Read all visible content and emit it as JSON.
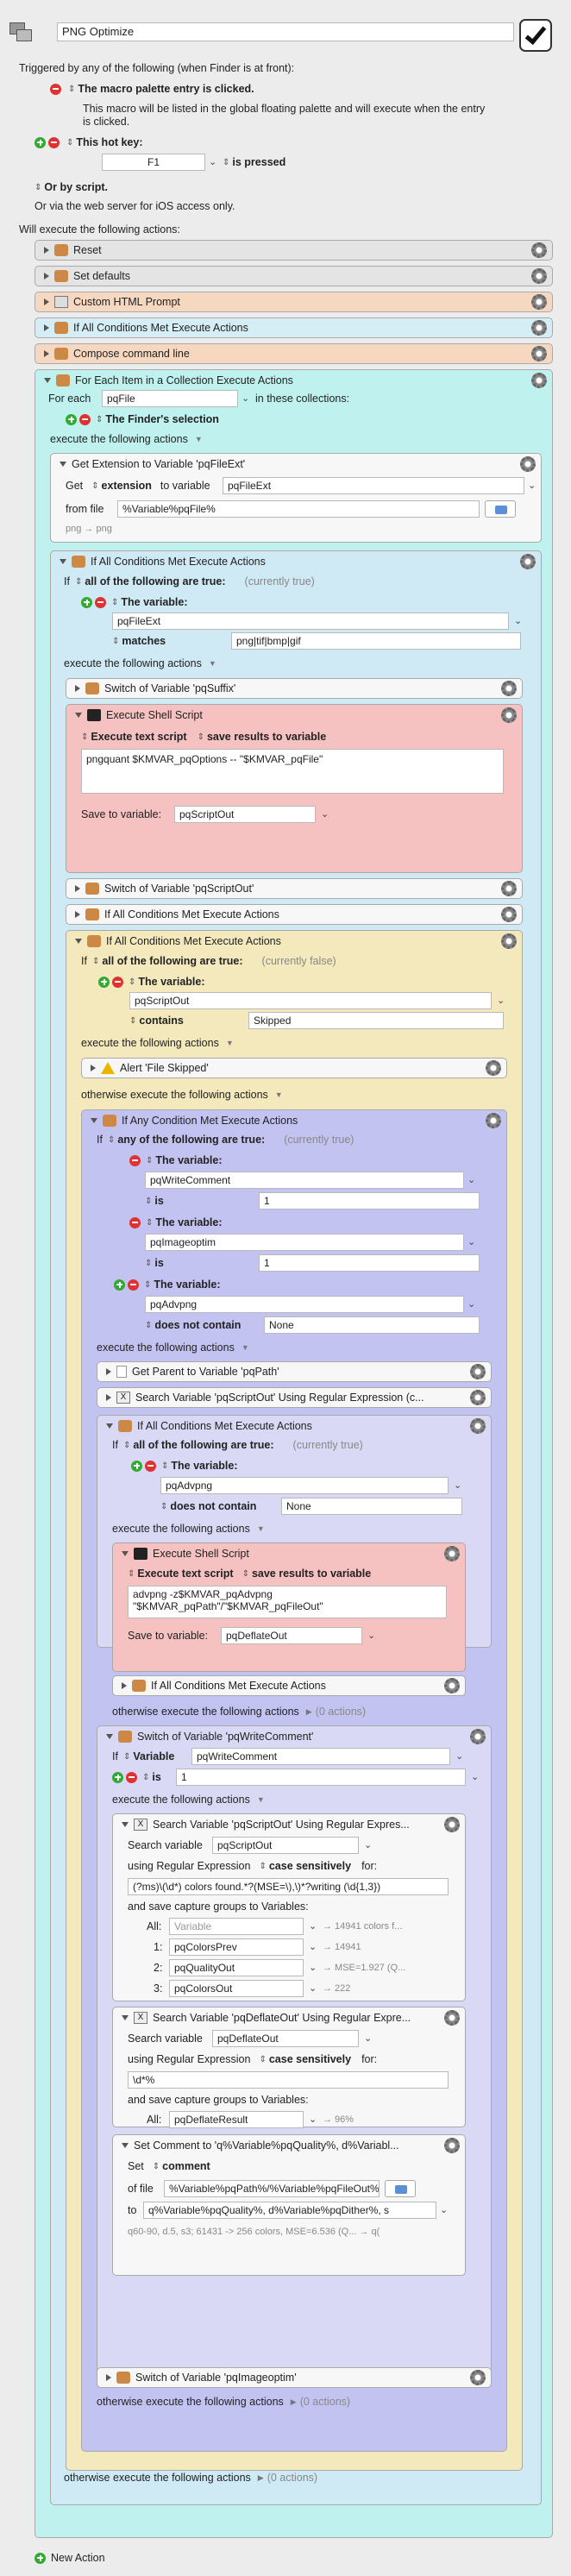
{
  "macro": {
    "name": "PNG Optimize"
  },
  "triggers": {
    "heading": "Triggered by any of the following (when Finder is at front):",
    "palette": "The macro palette entry is clicked.",
    "palette_desc1": "This macro will be listed in the global floating palette and will execute when the entry",
    "palette_desc2": "is clicked.",
    "hotkey": "This hot key:",
    "hotkey_value": "F1",
    "hotkey_mode": "is pressed",
    "script": "Or by script.",
    "web": "Or via the web server for iOS access only."
  },
  "will_execute": "Will execute the following actions:",
  "actions": {
    "reset": "Reset",
    "set_defaults": "Set defaults",
    "custom_html": "Custom HTML Prompt",
    "if_all": "If All Conditions Met Execute Actions",
    "compose": "Compose command line",
    "for_each": "For Each Item in a Collection Execute Actions"
  },
  "foreach": {
    "for_each": "For each",
    "var": "pqFile",
    "in_collections": "in these collections:",
    "selection": "The Finder's selection",
    "execute": "execute the following actions"
  },
  "getext": {
    "title": "Get Extension to Variable 'pqFileExt'",
    "get": "Get",
    "extension": "extension",
    "to_variable": "to variable",
    "var": "pqFileExt",
    "from_file": "from file",
    "file": "%Variable%pqFile%",
    "preview": "png → png"
  },
  "if1": {
    "title": "If All Conditions Met Execute Actions",
    "if": "If",
    "all": "all of the following are true:",
    "status": "(currently true)",
    "the_variable": "The variable:",
    "var": "pqFileExt",
    "matches": "matches",
    "pattern": "png|tif|bmp|gif",
    "execute": "execute the following actions"
  },
  "switch1": "Switch of Variable 'pqSuffix'",
  "shell1": {
    "title": "Execute Shell Script",
    "mode": "Execute text script",
    "save": "save results to variable",
    "script": "pngquant $KMVAR_pqOptions -- \"$KMVAR_pqFile\"",
    "save_to": "Save to variable:",
    "var": "pqScriptOut"
  },
  "switch2": "Switch of Variable 'pqScriptOut'",
  "if2": "If All Conditions Met Execute Actions",
  "if3": {
    "title": "If All Conditions Met Execute Actions",
    "if": "If",
    "all": "all of the following are true:",
    "status": "(currently false)",
    "the_variable": "The variable:",
    "var": "pqScriptOut",
    "contains": "contains",
    "value": "Skipped",
    "execute": "execute the following actions",
    "alert": "Alert 'File Skipped'",
    "otherwise": "otherwise execute the following actions"
  },
  "ifany": {
    "title": "If Any Condition Met Execute Actions",
    "if": "If",
    "any": "any of the following are true:",
    "status": "(currently true)",
    "c1_label": "The variable:",
    "c1_var": "pqWriteComment",
    "c1_op": "is",
    "c1_val": "1",
    "c2_label": "The variable:",
    "c2_var": "pqImageoptim",
    "c2_op": "is",
    "c2_val": "1",
    "c3_label": "The variable:",
    "c3_var": "pqAdvpng",
    "c3_op": "does not contain",
    "c3_val": "None",
    "execute": "execute the following actions"
  },
  "getparent": "Get Parent to Variable 'pqPath'",
  "searchre": "Search Variable 'pqScriptOut' Using Regular Expression (c...",
  "if4": {
    "title": "If All Conditions Met Execute Actions",
    "if": "If",
    "all": "all of the following are true:",
    "status": "(currently true)",
    "the_variable": "The variable:",
    "var": "pqAdvpng",
    "op": "does not contain",
    "val": "None",
    "execute": "execute the following actions"
  },
  "shell2": {
    "title": "Execute Shell Script",
    "mode": "Execute text script",
    "save": "save results to variable",
    "line1": "advpng -z$KMVAR_pqAdvpng",
    "line2": "\"$KMVAR_pqPath\"/\"$KMVAR_pqFileOut\"",
    "save_to": "Save to variable:",
    "var": "pqDeflateOut"
  },
  "if5": "If All Conditions Met Execute Actions",
  "otherwise_none": "otherwise execute the following actions",
  "zero_actions": "(0 actions)",
  "sw3": {
    "title": "Switch of Variable 'pqWriteComment'",
    "if": "If",
    "variable": "Variable",
    "var": "pqWriteComment",
    "is": "is",
    "val": "1",
    "execute": "execute the following actions"
  },
  "sr1": {
    "title": "Search Variable 'pqScriptOut' Using Regular Expres...",
    "search_var": "Search variable",
    "var": "pqScriptOut",
    "using": "using Regular Expression",
    "case": "case sensitively",
    "for": "for:",
    "pattern": "(?ms)\\(\\d*) colors found.*?(MSE=\\),\\)*?writing (\\d{1,3})",
    "save": "and save capture groups to Variables:",
    "all": "All:",
    "all_var": "Variable",
    "all_res": "→ 14941 colors f...",
    "g1": "1:",
    "g1_var": "pqColorsPrev",
    "g1_res": "→ 14941",
    "g2": "2:",
    "g2_var": "pqQualityOut",
    "g2_res": "→ MSE=1.927 (Q...",
    "g3": "3:",
    "g3_var": "pqColorsOut",
    "g3_res": "→ 222"
  },
  "sr2": {
    "title": "Search Variable 'pqDeflateOut' Using Regular Expre...",
    "search_var": "Search variable",
    "var": "pqDeflateOut",
    "using": "using Regular Expression",
    "case": "case sensitively",
    "for": "for:",
    "pattern": "\\d*%",
    "save": "and save capture groups to Variables:",
    "all": "All:",
    "all_var": "pqDeflateResult",
    "all_res": "→ 96%"
  },
  "setc": {
    "title": "Set Comment to 'q%Variable%pqQuality%, d%Variabl...",
    "set": "Set",
    "comment": "comment",
    "of_file": "of file",
    "file": "%Variable%pqPath%/%Variable%pqFileOut%",
    "to": "to",
    "value": "q%Variable%pqQuality%, d%Variable%pqDither%, s",
    "preview": "q60-90, d.5, s3; 61431 -> 256 colors, MSE=6.536 (Q... → q("
  },
  "sw4": "Switch of Variable 'pqImageoptim'",
  "new_action": "New Action"
}
